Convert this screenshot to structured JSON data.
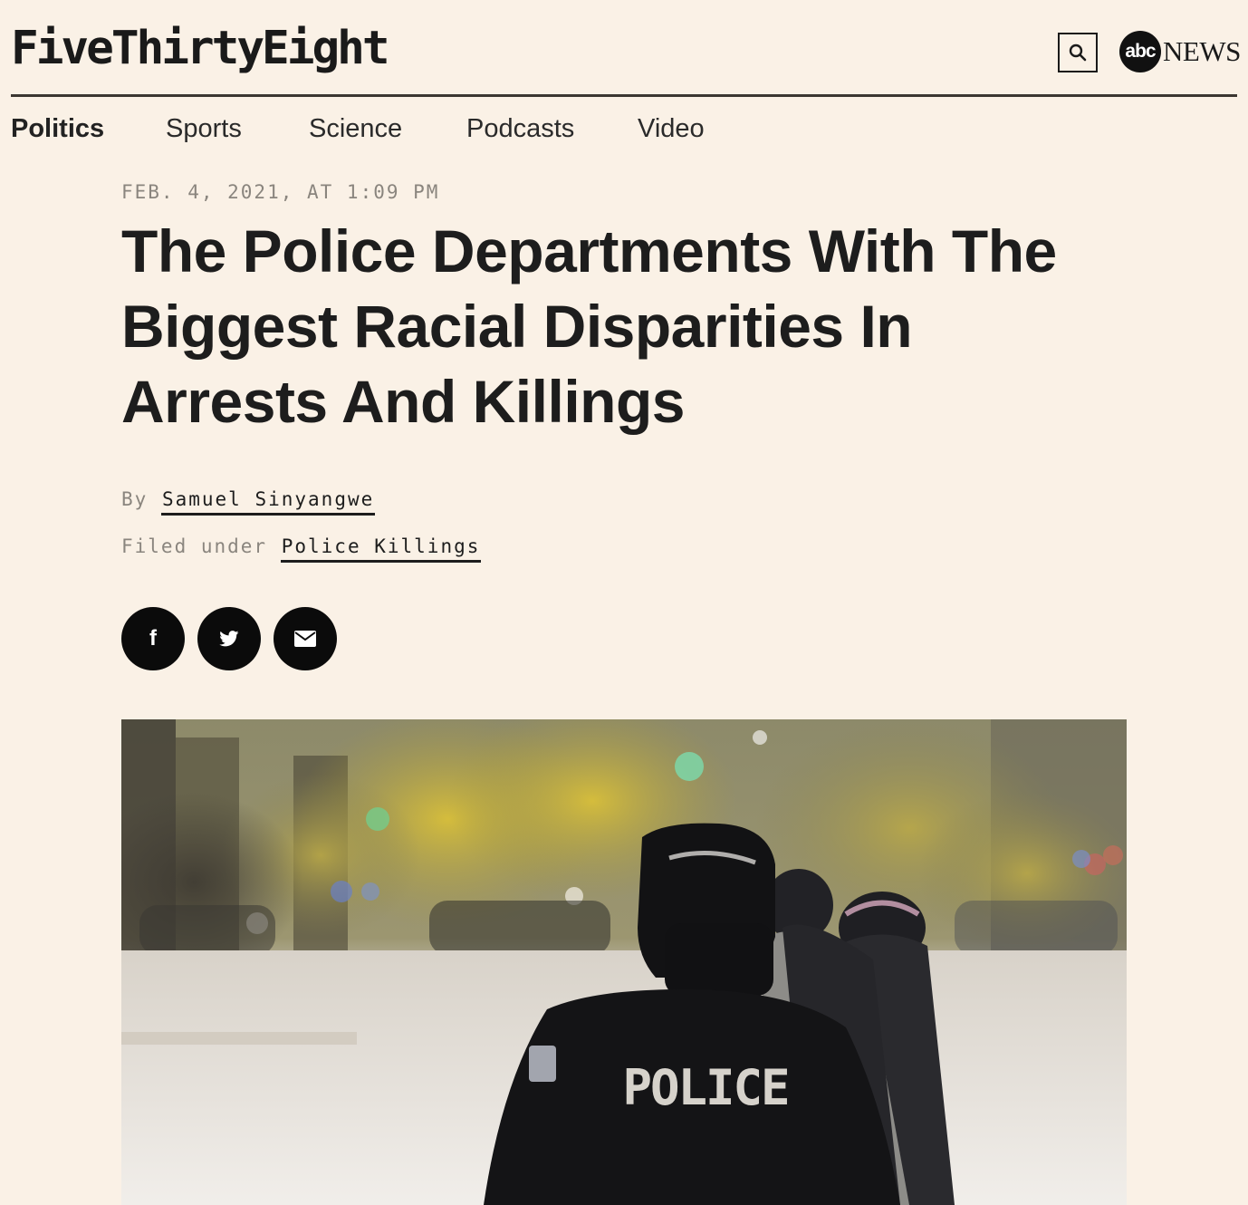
{
  "header": {
    "logo": "FiveThirtyEight",
    "partner_logo_abc": "abc",
    "partner_logo_news": "NEWS"
  },
  "nav": {
    "items": [
      {
        "label": "Politics",
        "active": true
      },
      {
        "label": "Sports",
        "active": false
      },
      {
        "label": "Science",
        "active": false
      },
      {
        "label": "Podcasts",
        "active": false
      },
      {
        "label": "Video",
        "active": false
      }
    ]
  },
  "article": {
    "dateline": "FEB. 4, 2021, AT 1:09 PM",
    "headline": "The Police Departments With The Biggest Racial Disparities In Arrests And Killings",
    "byline_prefix": "By",
    "author": "Samuel Sinyangwe",
    "filed_prefix": "Filed under",
    "topic": "Police Killings",
    "hero_text": "POLICE"
  },
  "share": {
    "facebook_glyph": "f",
    "icons": [
      "facebook-icon",
      "twitter-icon",
      "email-icon"
    ]
  }
}
